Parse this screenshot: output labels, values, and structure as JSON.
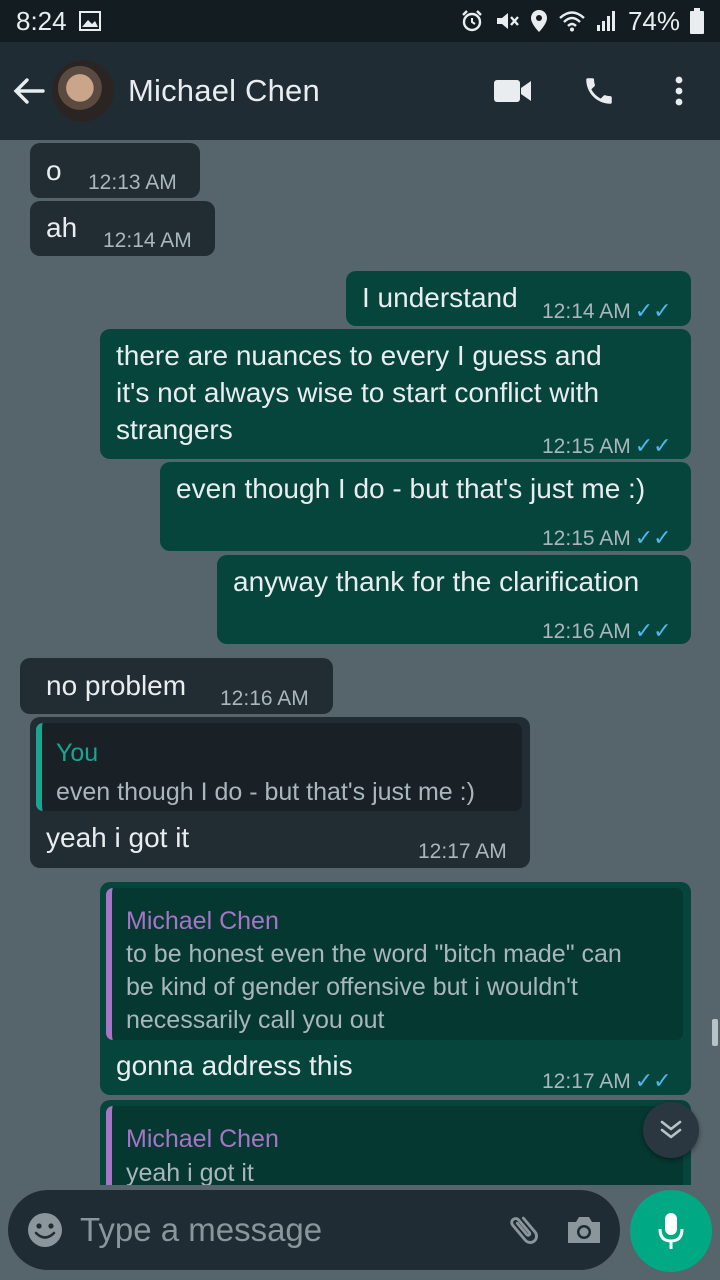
{
  "status_bar": {
    "time": "8:24",
    "battery": "74%"
  },
  "header": {
    "contact_name": "Michael Chen"
  },
  "messages": [
    {
      "dir": "in",
      "text": "o",
      "time": "12:13 AM"
    },
    {
      "dir": "in",
      "text": "ah",
      "time": "12:14 AM"
    },
    {
      "dir": "out",
      "text": "I understand",
      "time": "12:14 AM"
    },
    {
      "dir": "out",
      "lines": [
        "there are nuances to every I guess and",
        "it's not always wise to start conflict with",
        "strangers"
      ],
      "time": "12:15 AM"
    },
    {
      "dir": "out",
      "text": "even though I do - but that's just me :)",
      "time": "12:15 AM"
    },
    {
      "dir": "out",
      "text": "anyway thank for the clarification",
      "time": "12:16 AM"
    },
    {
      "dir": "in",
      "text": "no problem",
      "time": "12:16 AM"
    },
    {
      "dir": "in",
      "quote_author": "You",
      "quote_text": "even though I do - but that's just me :)",
      "text": "yeah i got it",
      "time": "12:17 AM"
    },
    {
      "dir": "out",
      "quote_author": "Michael Chen",
      "quote_lines": [
        "to be honest even the word \"bitch made\" can",
        "be kind of gender offensive but i wouldn't",
        "necessarily call you out"
      ],
      "text": "gonna address this",
      "time": "12:17 AM"
    },
    {
      "dir": "out",
      "quote_author": "Michael Chen",
      "quote_text": "yeah i got it"
    }
  ],
  "input": {
    "placeholder": "Type a message"
  },
  "colors": {
    "chat_background": "#56656b",
    "incoming_bubble": "#212d33",
    "outgoing_bubble": "#05453c",
    "read_ticks": "#4fb6ec",
    "quote_you": "#1aa591",
    "quote_contact": "#a774c6",
    "mic_button": "#01a884"
  },
  "icons": {
    "status_left": [
      "image-icon"
    ],
    "status_right": [
      "alarm-icon",
      "mute-icon",
      "location-icon",
      "wifi-icon",
      "signal-icon",
      "battery-icon"
    ],
    "header": [
      "back-arrow-icon",
      "video-call-icon",
      "phone-icon",
      "more-vertical-icon"
    ],
    "input": [
      "emoji-icon",
      "paperclip-icon",
      "camera-icon",
      "mic-icon",
      "double-chevron-down-icon"
    ]
  }
}
